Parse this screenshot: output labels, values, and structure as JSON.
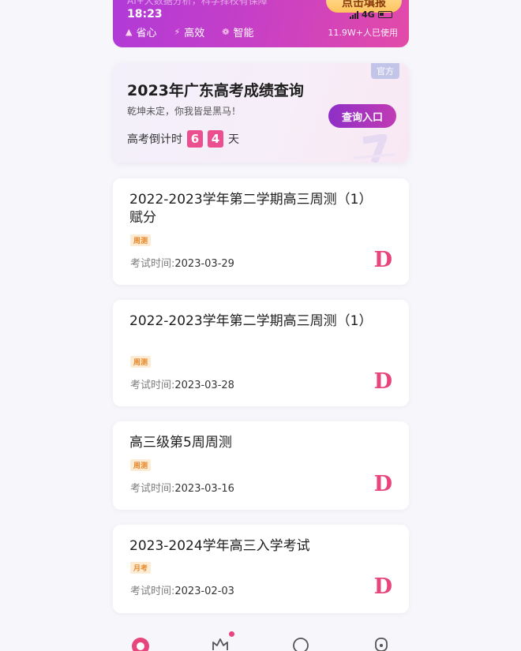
{
  "banner": {
    "subtitle": "AI+大数据分析，科学择校有保障",
    "status_time": "18:23",
    "status_network": "4G",
    "fill_button": "点击填报",
    "features": [
      {
        "label": "省心",
        "icon": "leaf-icon"
      },
      {
        "label": "高效",
        "icon": "lightning-icon"
      },
      {
        "label": "智能",
        "icon": "brain-icon"
      }
    ],
    "users": "11.9W+人已使用"
  },
  "gaokao_card": {
    "tag": "官方",
    "title": "2023年广东高考成绩查询",
    "subtitle": "乾坤未定，你我皆是黑马！",
    "countdown_label": "高考倒计时",
    "countdown_digits": [
      "6",
      "4"
    ],
    "countdown_unit": "天",
    "button": "查询入口"
  },
  "exams": [
    {
      "title": "2022-2023学年第二学期高三周测（1）赋分",
      "tag": "周测",
      "time_label": "考试时间:",
      "time": "2023-03-29",
      "grade": "D"
    },
    {
      "title": "2022-2023学年第二学期高三周测（1）",
      "tag": "周测",
      "time_label": "考试时间:",
      "time": "2023-03-28",
      "grade": "D"
    },
    {
      "title": "高三级第5周周测",
      "tag": "周测",
      "time_label": "考试时间:",
      "time": "2023-03-16",
      "grade": "D"
    },
    {
      "title": "2023-2024学年高三入学考试",
      "tag": "月考",
      "time_label": "考试时间:",
      "time": "2023-02-03",
      "grade": "D"
    }
  ],
  "colors": {
    "accent": "#e8457d",
    "banner_start": "#b13ad7",
    "banner_end": "#e34aa9",
    "tag_text": "#e8892b"
  }
}
